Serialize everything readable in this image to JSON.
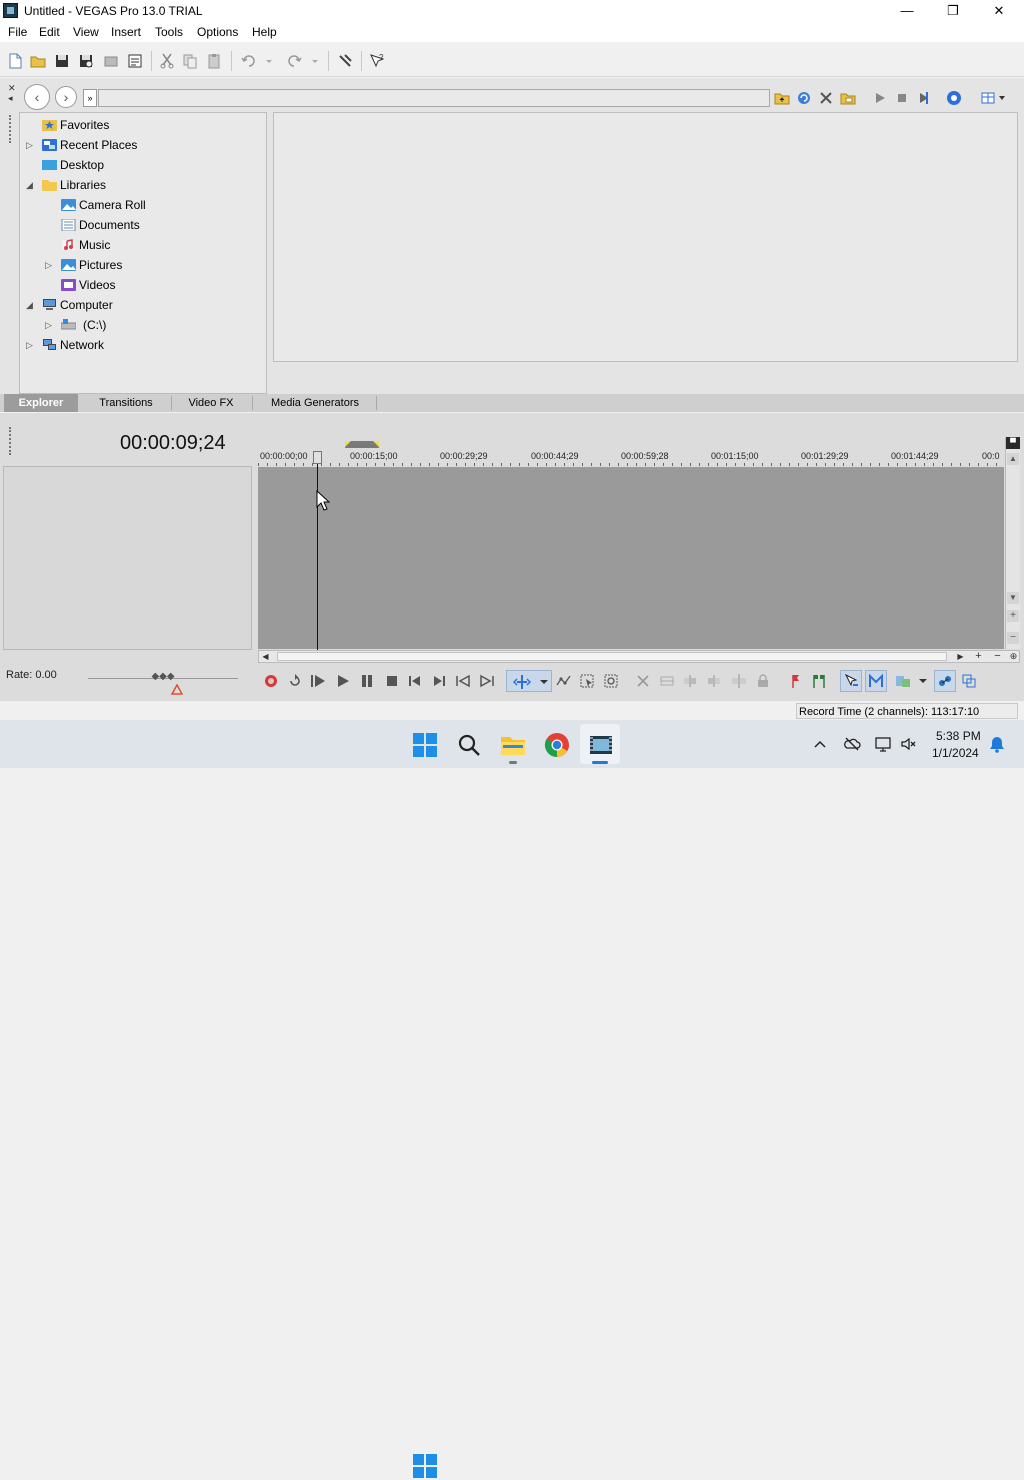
{
  "window": {
    "title": "Untitled - VEGAS Pro 13.0 TRIAL",
    "minimize": "—",
    "maximize": "❐",
    "close": "✕"
  },
  "menu": [
    "File",
    "Edit",
    "View",
    "Insert",
    "Tools",
    "Options",
    "Help"
  ],
  "explorer": {
    "path_value": "",
    "tree": [
      {
        "label": "Favorites",
        "icon": "favorites-star-icon",
        "indent": 0,
        "expander": ""
      },
      {
        "label": "Recent Places",
        "icon": "recent-places-icon",
        "indent": 0,
        "expander": "▷"
      },
      {
        "label": "Desktop",
        "icon": "desktop-icon",
        "indent": 0,
        "expander": ""
      },
      {
        "label": "Libraries",
        "icon": "folder-icon",
        "indent": 0,
        "expander": "◢"
      },
      {
        "label": "Camera Roll",
        "icon": "image-icon",
        "indent": 1,
        "expander": ""
      },
      {
        "label": "Documents",
        "icon": "document-icon",
        "indent": 1,
        "expander": ""
      },
      {
        "label": "Music",
        "icon": "music-icon",
        "indent": 1,
        "expander": ""
      },
      {
        "label": "Pictures",
        "icon": "image-icon",
        "indent": 1,
        "expander": "▷"
      },
      {
        "label": "Videos",
        "icon": "video-icon",
        "indent": 1,
        "expander": ""
      },
      {
        "label": "Computer",
        "icon": "computer-icon",
        "indent": 0,
        "expander": "◢"
      },
      {
        "label": "(C:\\)",
        "icon": "drive-icon",
        "indent": 1,
        "expander": "▷"
      },
      {
        "label": "Network",
        "icon": "network-icon",
        "indent": 0,
        "expander": "▷"
      }
    ]
  },
  "tabs": [
    {
      "label": "Explorer",
      "active": true
    },
    {
      "label": "Transitions",
      "active": false
    },
    {
      "label": "Video FX",
      "active": false
    },
    {
      "label": "Media Generators",
      "active": false
    }
  ],
  "timeline": {
    "current_time": "00:00:09;24",
    "ruler_labels": [
      "00:00:00;00",
      "00:00:15;00",
      "00:00:29;29",
      "00:00:44;29",
      "00:00:59;28",
      "00:01:15;00",
      "00:01:29;29",
      "00:01:44;29",
      "00:0"
    ],
    "rate": "Rate: 0.00"
  },
  "status": {
    "record_time": "Record Time (2 channels): 113:17:10"
  },
  "taskbar": {
    "time": "5:38 PM",
    "date": "1/1/2024"
  },
  "colors": {
    "accent_blue": "#2f6fd8",
    "record_red": "#d03a3a",
    "timeline_gray": "#9a9a9a"
  }
}
